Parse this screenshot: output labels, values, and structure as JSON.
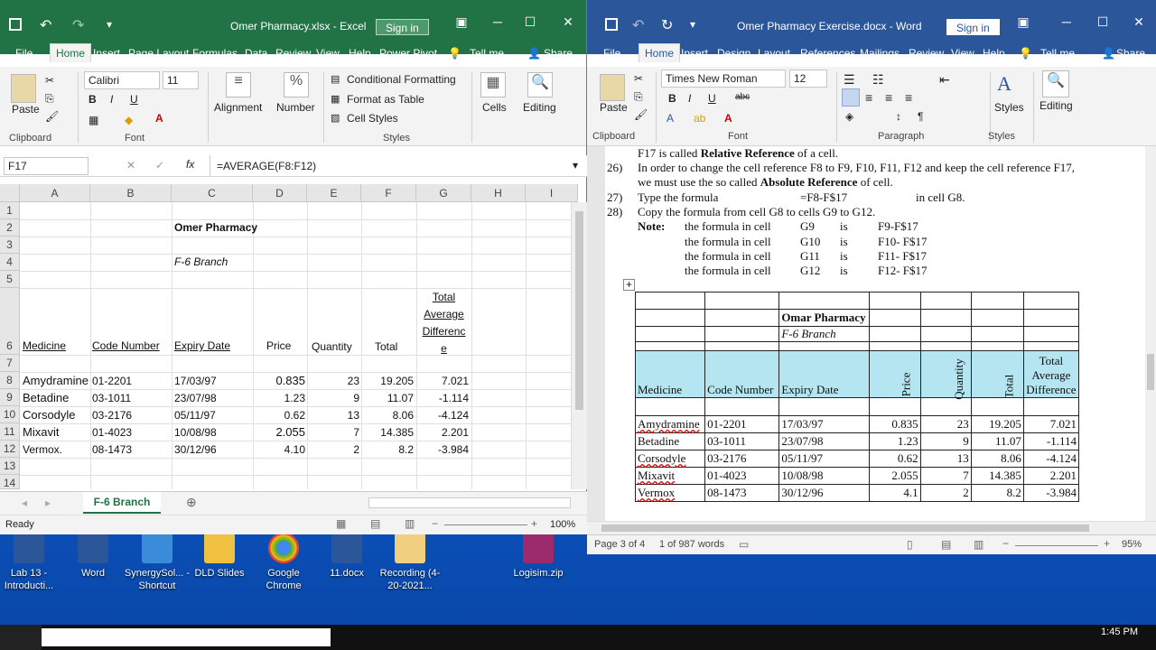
{
  "desktop": {
    "icons": [
      {
        "label": "Lab 13 - Introducti...",
        "color": "#2b579a"
      },
      {
        "label": "Word",
        "color": "#2b579a"
      },
      {
        "label": "SynergySol... - Shortcut",
        "color": "#3a8bd8"
      },
      {
        "label": "DLD Slides",
        "color": "#f0c040"
      },
      {
        "label": "Google Chrome",
        "color": "#dd4b39"
      },
      {
        "label": "11.docx",
        "color": "#2b579a"
      },
      {
        "label": "Recording (4-20-2021...",
        "color": "#f0d080"
      },
      {
        "label": "Logisim.zip",
        "color": "#9b2b6a"
      }
    ],
    "clock": "1:45 PM"
  },
  "excel": {
    "title": "Omer Pharmacy.xlsx - Excel",
    "signin": "Sign in",
    "tabs": [
      "File",
      "Home",
      "Insert",
      "Page Layout",
      "Formulas",
      "Data",
      "Review",
      "View",
      "Help",
      "Power Pivot",
      "Tell me",
      "Share"
    ],
    "ribbon": {
      "paste": "Paste",
      "clipboard": "Clipboard",
      "font_name": "Calibri",
      "font_size": "11",
      "font": "Font",
      "alignment": "Alignment",
      "number": "Number",
      "cond_format": "Conditional Formatting",
      "format_table": "Format as Table",
      "cell_styles": "Cell Styles",
      "styles": "Styles",
      "cells": "Cells",
      "editing": "Editing"
    },
    "namebox": "F17",
    "formula": "=AVERAGE(F8:F12)",
    "columns": [
      "A",
      "B",
      "C",
      "D",
      "E",
      "F",
      "G",
      "H",
      "I"
    ],
    "rows": [
      "1",
      "2",
      "3",
      "4",
      "5",
      "6",
      "7",
      "8",
      "9",
      "10",
      "11",
      "12",
      "13",
      "14"
    ],
    "title_cell": "Omer Pharmacy",
    "branch_cell": "F-6 Branch",
    "headers": {
      "medicine": "Medicine",
      "code": "Code Number",
      "expiry": "Expiry Date",
      "price": "Price",
      "qty": "Quantity",
      "total": "Total",
      "diff1": "Total",
      "diff2": "Average",
      "diff3": "Differenc",
      "diff4": "e"
    },
    "data": [
      {
        "medicine": "Amydramine",
        "code": "01-2201",
        "expiry": "17/03/97",
        "price": "0.835",
        "qty": "23",
        "total": "19.205",
        "diff": "7.021"
      },
      {
        "medicine": "Betadine",
        "code": "03-1011",
        "expiry": "23/07/98",
        "price": "1.23",
        "qty": "9",
        "total": "11.07",
        "diff": "-1.114"
      },
      {
        "medicine": "Corsodyle",
        "code": "03-2176",
        "expiry": "05/11/97",
        "price": "0.62",
        "qty": "13",
        "total": "8.06",
        "diff": "-4.124"
      },
      {
        "medicine": "Mixavit",
        "code": "01-4023",
        "expiry": "10/08/98",
        "price": "2.055",
        "qty": "7",
        "total": "14.385",
        "diff": "2.201"
      },
      {
        "medicine": "Vermox.",
        "code": "08-1473",
        "expiry": "30/12/96",
        "price": "4.10",
        "qty": "2",
        "total": "8.2",
        "diff": "-3.984"
      }
    ],
    "sheet_tab": "F-6 Branch",
    "status": "Ready",
    "zoom": "100%"
  },
  "word": {
    "title": "Omer Pharmacy Exercise.docx - Word",
    "signin": "Sign in",
    "tabs": [
      "File",
      "Home",
      "Insert",
      "Design",
      "Layout",
      "References",
      "Mailings",
      "Review",
      "View",
      "Help",
      "Tell me",
      "Share"
    ],
    "ribbon": {
      "paste": "Paste",
      "clipboard": "Clipboard",
      "font_name": "Times New Roman",
      "font_size": "12",
      "font": "Font",
      "paragraph": "Paragraph",
      "styles": "Styles",
      "styles_group": "Styles",
      "editing": "Editing"
    },
    "lines": {
      "l0a": "F17 is called ",
      "l0b": "Relative Reference",
      "l0c": " of a cell.",
      "n26": "26)",
      "l26a": "In order to change the cell reference F8 to F9, F10, F11, F12 and keep the cell reference F17,",
      "l26b": "we must use the so called ",
      "l26c": "Absolute Reference",
      "l26d": " of cell.",
      "n27": "27)",
      "l27a": "Type the formula",
      "l27b": "=F8-F$17",
      "l27c": "in cell G8.",
      "n28": "28)",
      "l28a": "Copy the formula from cell G8 to cells G9 to G12.",
      "note": "Note:",
      "notes": [
        {
          "a": "the formula in cell",
          "b": "G9",
          "c": "is",
          "d": "F9-F$17"
        },
        {
          "a": "the formula in cell",
          "b": "G10",
          "c": "is",
          "d": "F10- F$17"
        },
        {
          "a": "the formula in cell",
          "b": "G11",
          "c": "is",
          "d": "F11- F$17"
        },
        {
          "a": "the formula in cell",
          "b": "G12",
          "c": "is",
          "d": "F12- F$17"
        }
      ]
    },
    "table": {
      "title": "Omar Pharmacy",
      "branch": "F-6  Branch",
      "h": {
        "medicine": "Medicine",
        "code": "Code Number",
        "expiry": "Expiry Date",
        "price": "Price",
        "qty": "Quantity",
        "total": "Total",
        "diff1": "Total",
        "diff2": "Average",
        "diff3": "Difference"
      },
      "rows": [
        {
          "medicine": "Amydramine",
          "code": "01-2201",
          "expiry": "17/03/97",
          "price": "0.835",
          "qty": "23",
          "total": "19.205",
          "diff": "7.021"
        },
        {
          "medicine": "Betadine",
          "code": "03-1011",
          "expiry": "23/07/98",
          "price": "1.23",
          "qty": "9",
          "total": "11.07",
          "diff": "-1.114"
        },
        {
          "medicine": "Corsodyle",
          "code": "03-2176",
          "expiry": "05/11/97",
          "price": "0.62",
          "qty": "13",
          "total": "8.06",
          "diff": "-4.124"
        },
        {
          "medicine": "Mixavit",
          "code": "01-4023",
          "expiry": "10/08/98",
          "price": "2.055",
          "qty": "7",
          "total": "14.385",
          "diff": "2.201"
        },
        {
          "medicine": "Vermox",
          "code": "08-1473",
          "expiry": "30/12/96",
          "price": "4.1",
          "qty": "2",
          "total": "8.2",
          "diff": "-3.984"
        }
      ]
    },
    "status": {
      "page": "Page 3 of 4",
      "words": "1 of 987 words",
      "zoom": "95%"
    }
  }
}
